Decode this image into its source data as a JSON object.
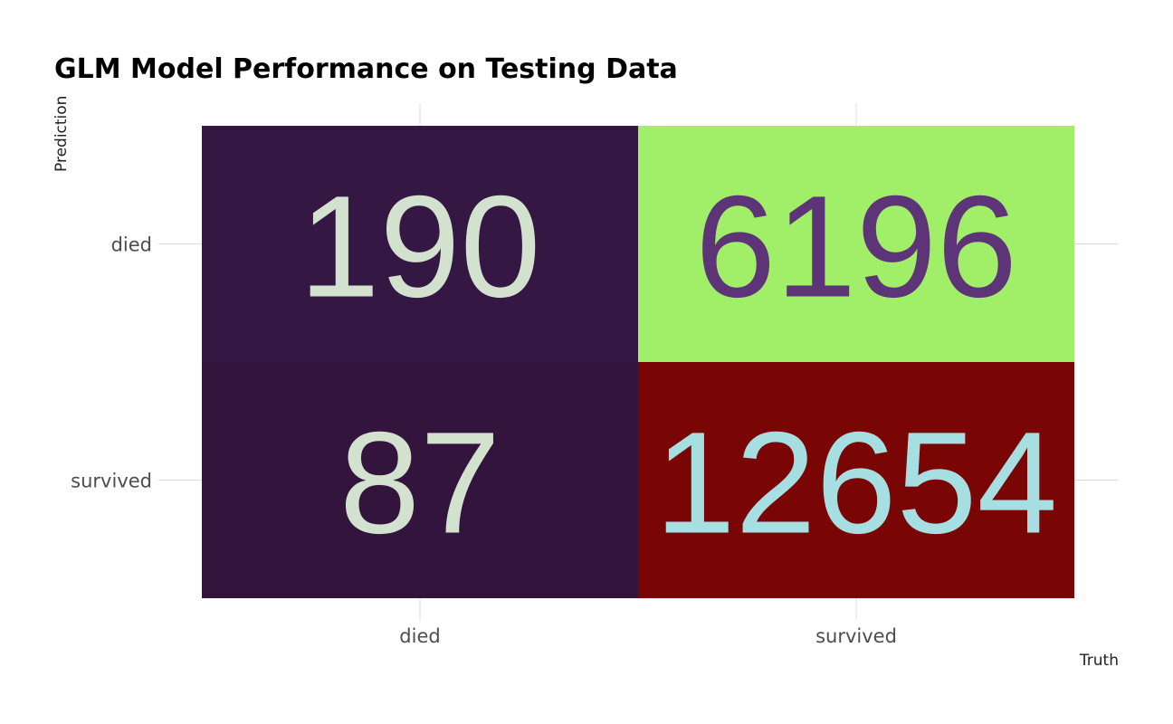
{
  "chart_data": {
    "type": "heatmap",
    "title": "GLM Model Performance on Testing Data",
    "xlabel": "Truth",
    "ylabel": "Prediction",
    "x_categories": [
      "died",
      "survived"
    ],
    "y_categories": [
      "died",
      "survived"
    ],
    "cells": [
      {
        "truth": "died",
        "prediction": "died",
        "value": 190,
        "label": "190",
        "fill": "#341843",
        "text_color": "#d3e2cf"
      },
      {
        "truth": "survived",
        "prediction": "died",
        "value": 6196,
        "label": "6196",
        "fill": "#a1ee68",
        "text_color": "#5e3479"
      },
      {
        "truth": "died",
        "prediction": "survived",
        "value": 87,
        "label": "87",
        "fill": "#33143c",
        "text_color": "#d3e2cf"
      },
      {
        "truth": "survived",
        "prediction": "survived",
        "value": 12654,
        "label": "12654",
        "fill": "#790605",
        "text_color": "#a5dfe2"
      }
    ],
    "grid": true,
    "legend": "none"
  }
}
